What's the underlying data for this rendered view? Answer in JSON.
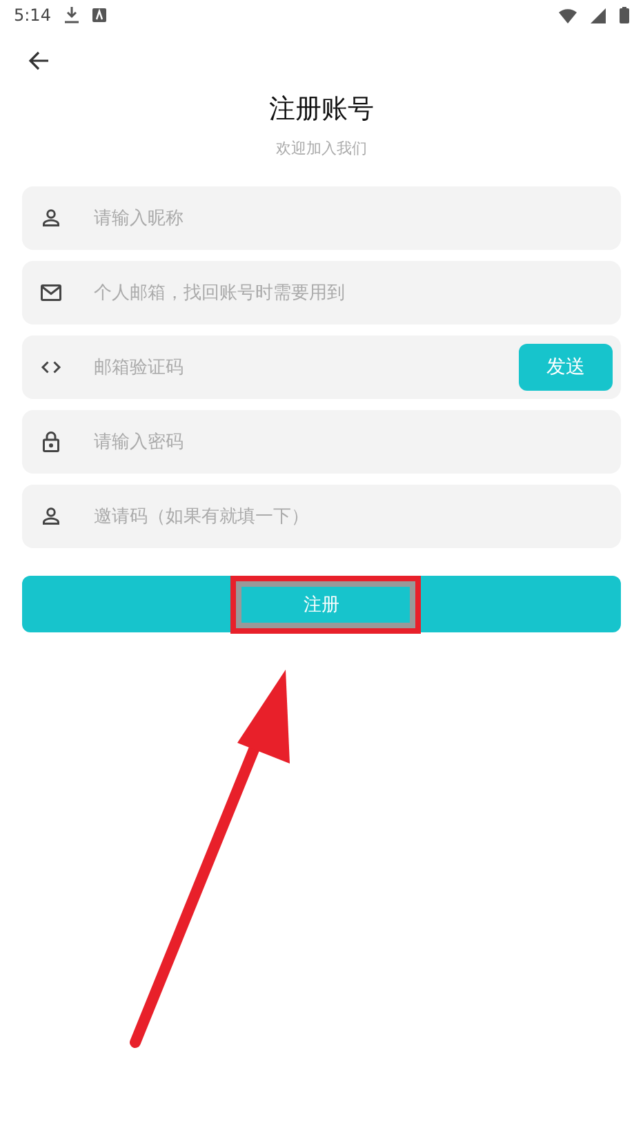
{
  "status_bar": {
    "time": "5:14"
  },
  "header": {
    "title": "注册账号",
    "subtitle": "欢迎加入我们"
  },
  "fields": [
    {
      "kind": "person",
      "placeholder": "请输入昵称"
    },
    {
      "kind": "mail",
      "placeholder": "个人邮箱，找回账号时需要用到"
    },
    {
      "kind": "code",
      "placeholder": "邮箱验证码",
      "button": "发送"
    },
    {
      "kind": "lock",
      "placeholder": "请输入密码"
    },
    {
      "kind": "person",
      "placeholder": "邀请码（如果有就填一下）"
    }
  ],
  "submit": {
    "label": "注册"
  },
  "annotation": {
    "highlight": true,
    "arrow": true
  }
}
